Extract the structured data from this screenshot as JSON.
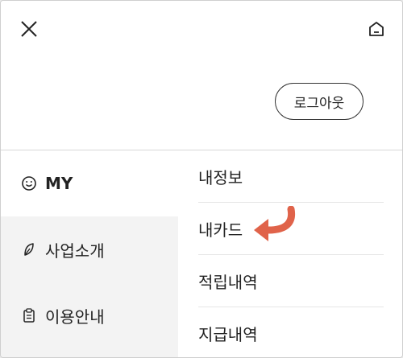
{
  "header": {
    "close_icon": "close-icon",
    "home_icon": "home-icon",
    "logout_label": "로그아웃"
  },
  "categories": [
    {
      "label": "MY",
      "icon": "smiley-icon",
      "active": true
    },
    {
      "label": "사업소개",
      "icon": "leaf-icon",
      "active": false
    },
    {
      "label": "이용안내",
      "icon": "clipboard-icon",
      "active": false
    }
  ],
  "submenu": [
    {
      "label": "내정보"
    },
    {
      "label": "내카드"
    },
    {
      "label": "적립내역"
    },
    {
      "label": "지급내역"
    }
  ],
  "annotation": {
    "icon": "curved-arrow-icon",
    "color": "#e0634a"
  }
}
